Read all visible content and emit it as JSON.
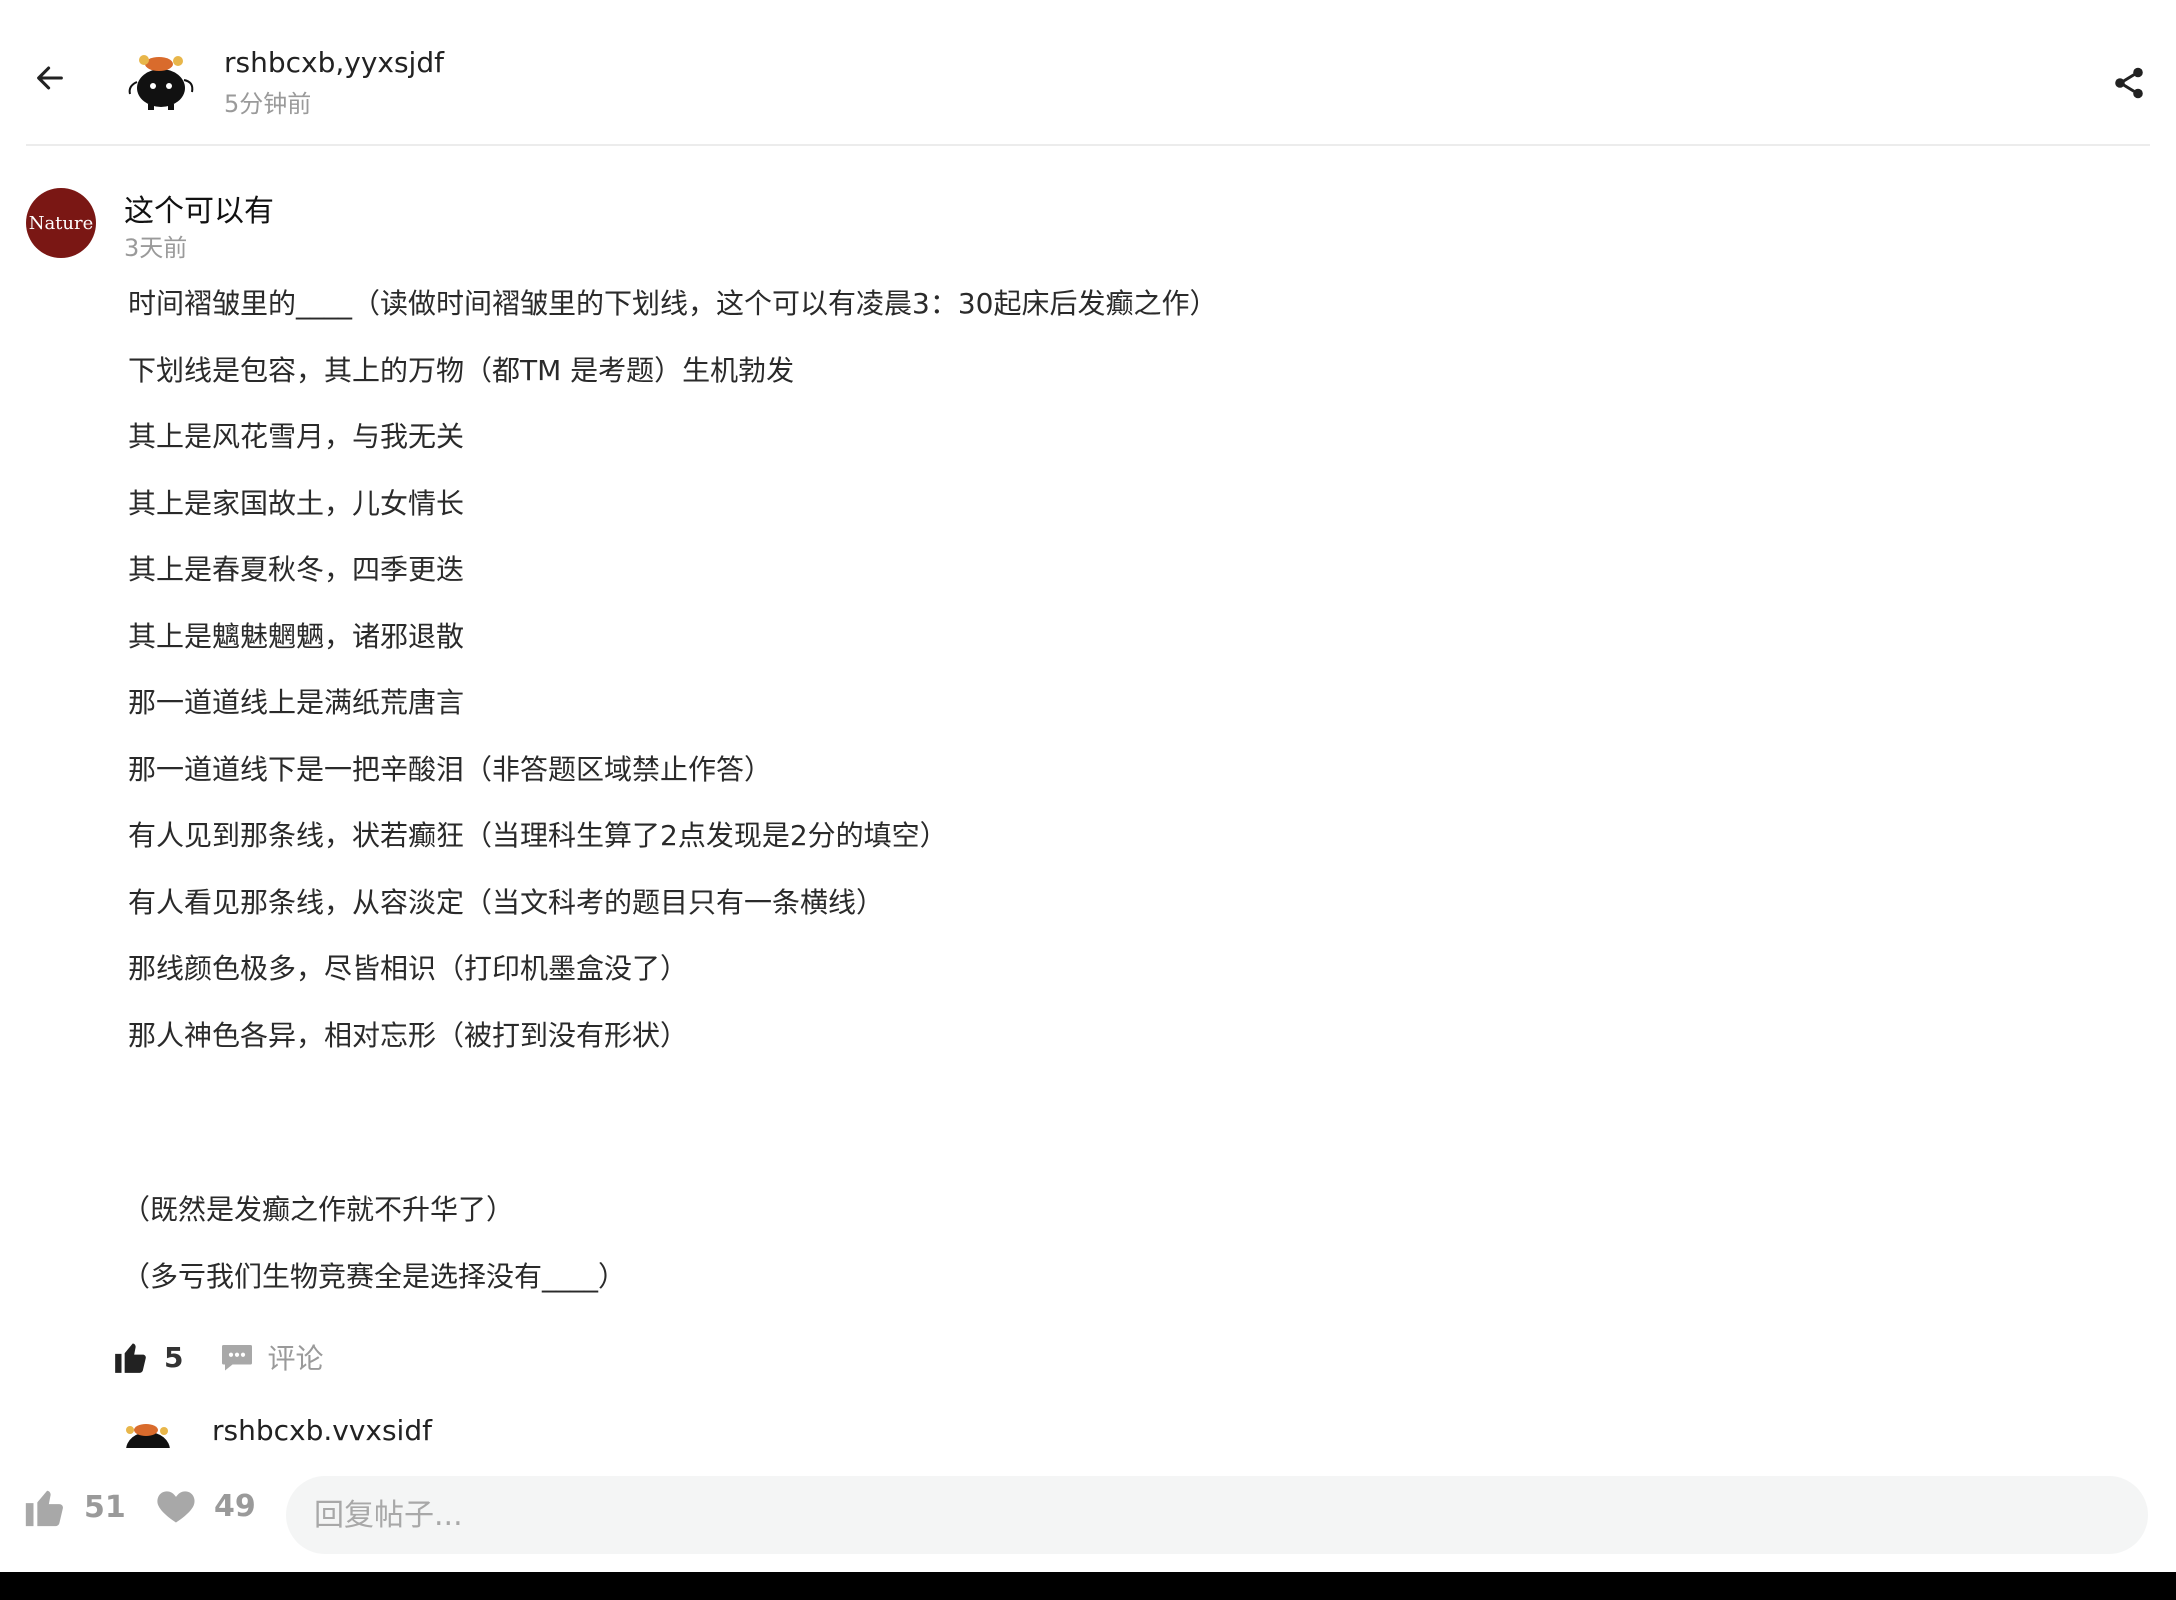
{
  "header": {
    "author_name": "rshbcxb,yyxsjdf",
    "posted_time": "5分钟前"
  },
  "post": {
    "avatar_text": "Nature",
    "title": "这个可以有",
    "time": "3天前",
    "lines": [
      "时间褶皱里的____（读做时间褶皱里的下划线，这个可以有凌晨3：30起床后发癫之作）",
      "下划线是包容，其上的万物（都TM 是考题）生机勃发",
      "其上是风花雪月，与我无关",
      "其上是家国故土，儿女情长",
      "其上是春夏秋冬，四季更迭",
      "其上是魑魅魍魉，诸邪退散",
      "那一道道线上是满纸荒唐言",
      "那一道道线下是一把辛酸泪（非答题区域禁止作答）",
      "有人见到那条线，状若癫狂（当理科生算了2点发现是2分的填空）",
      "有人看见那条线，从容淡定（当文科考的题目只有一条横线）",
      "那线颜色极多，尽皆相识（打印机墨盒没了）",
      "那人神色各异，相对忘形（被打到没有形状）"
    ],
    "afterword": [
      "（既然是发癫之作就不升华了）",
      "（多亏我们生物竞赛全是选择没有____）"
    ],
    "like_count": "5",
    "comment_label": "评论"
  },
  "reply_preview": {
    "author_name": "rshbcxb.vvxsidf"
  },
  "bottom_bar": {
    "like_count": "51",
    "favorite_count": "49",
    "reply_placeholder": "回复帖子..."
  },
  "colors": {
    "accent_avatar": "#7a1714",
    "muted_text": "#9a9a9a",
    "input_bg": "#f4f5f5"
  }
}
